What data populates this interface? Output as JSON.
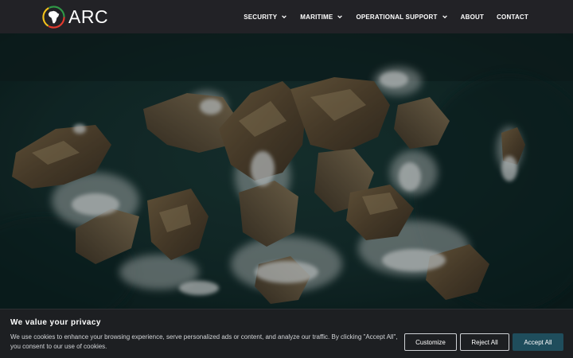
{
  "header": {
    "logo_text": "ARC",
    "nav": [
      {
        "label": "SECURITY",
        "has_dropdown": true
      },
      {
        "label": "MARITIME",
        "has_dropdown": true
      },
      {
        "label": "OPERATIONAL SUPPORT",
        "has_dropdown": true
      },
      {
        "label": "ABOUT",
        "has_dropdown": false
      },
      {
        "label": "CONTACT",
        "has_dropdown": false
      }
    ]
  },
  "hero": {
    "image": "aerial-coastal-rocks-waves"
  },
  "cookie_banner": {
    "title": "We value your privacy",
    "text": "We use cookies to enhance your browsing experience, serve personalized ads or content, and analyze our traffic. By clicking \"Accept All\", you consent to our use of cookies.",
    "buttons": {
      "customize": "Customize",
      "reject_all": "Reject All",
      "accept_all": "Accept All"
    }
  },
  "colors": {
    "header_bg": "#222226",
    "accept_bg": "#1f4d5c",
    "sea": "#14302f",
    "rock": "#6b5a3f"
  },
  "icons": {
    "logo": "africa-globe-icon",
    "dropdown": "chevron-down-icon"
  }
}
